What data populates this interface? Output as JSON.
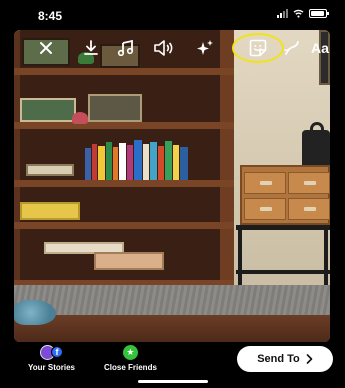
{
  "status_bar": {
    "time": "8:45",
    "icons": [
      "signal-icon",
      "wifi-icon",
      "battery-icon"
    ]
  },
  "toolbar": {
    "items": [
      {
        "name": "close",
        "icon": "close-icon"
      },
      {
        "name": "download",
        "icon": "download-icon"
      },
      {
        "name": "music",
        "icon": "music-icon"
      },
      {
        "name": "sound",
        "icon": "speaker-icon"
      },
      {
        "name": "effects",
        "icon": "sparkles-icon"
      },
      {
        "name": "sticker",
        "icon": "sticker-icon",
        "highlighted": true
      },
      {
        "name": "draw",
        "icon": "draw-icon"
      },
      {
        "name": "text",
        "icon": "text-icon",
        "label": "Aa"
      }
    ],
    "highlight_color": "#f2e318"
  },
  "share": {
    "your_stories_label": "Your Stories",
    "close_friends_label": "Close Friends",
    "send_to_label": "Send To",
    "send_to_icon": "chevron-right-icon"
  },
  "colors": {
    "stories_avatar": "#7d4bd8",
    "facebook": "#2d6ef0",
    "close_friends": "#34c23a"
  }
}
